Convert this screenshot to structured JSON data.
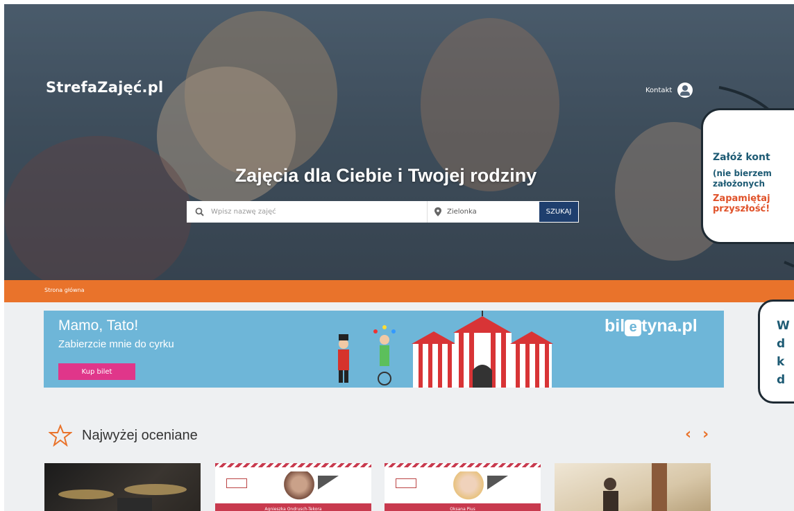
{
  "header": {
    "logo": "StrefaZajęć.pl",
    "contact_label": "Kontakt"
  },
  "hero": {
    "title": "Zajęcia dla Ciebie i Twojej rodziny",
    "search": {
      "name_placeholder": "Wpisz nazwę zajęć",
      "location_value": "Zielonka",
      "button_label": "SZUKAJ"
    }
  },
  "annotations": {
    "bubble1_title": "Załóż kont",
    "bubble1_line1": "(nie bierzem",
    "bubble1_line2": "założonych",
    "bubble1_warn1": "Zapamiętaj",
    "bubble1_warn2": "przyszłość!",
    "bubble2_letters": [
      "W",
      "d",
      "k",
      "d"
    ]
  },
  "breadcrumb": {
    "home": "Strona główna"
  },
  "banner": {
    "headline": "Mamo, Tato!",
    "subline": "Zabierzcie mnie do cyrku",
    "button_label": "Kup bilet",
    "brand_left": "bil",
    "brand_mid": "e",
    "brand_right": "tyna.pl"
  },
  "top_rated": {
    "title": "Najwyżej oceniane",
    "cards": [
      {
        "name": ""
      },
      {
        "name": "Agnieszka Ondrusch-Tekora"
      },
      {
        "name": "Oksana Pius"
      },
      {
        "name": ""
      }
    ]
  },
  "colors": {
    "accent_orange": "#e9732b",
    "search_button": "#1f3f6e",
    "banner_blue": "#6eb6d8",
    "banner_button": "#e0368a",
    "annotation_text": "#1e5b74",
    "annotation_warn": "#e0522a"
  }
}
